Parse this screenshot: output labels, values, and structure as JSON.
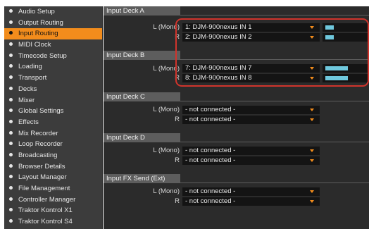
{
  "sidebar": {
    "items": [
      {
        "label": "Audio Setup",
        "active": false
      },
      {
        "label": "Output Routing",
        "active": false
      },
      {
        "label": "Input Routing",
        "active": true
      },
      {
        "label": "MIDI Clock",
        "active": false
      },
      {
        "label": "Timecode Setup",
        "active": false
      },
      {
        "label": "Loading",
        "active": false
      },
      {
        "label": "Transport",
        "active": false
      },
      {
        "label": "Decks",
        "active": false
      },
      {
        "label": "Mixer",
        "active": false
      },
      {
        "label": "Global Settings",
        "active": false
      },
      {
        "label": "Effects",
        "active": false
      },
      {
        "label": "Mix Recorder",
        "active": false
      },
      {
        "label": "Loop Recorder",
        "active": false
      },
      {
        "label": "Broadcasting",
        "active": false
      },
      {
        "label": "Browser Details",
        "active": false
      },
      {
        "label": "Layout Manager",
        "active": false
      },
      {
        "label": "File Management",
        "active": false
      },
      {
        "label": "Controller Manager",
        "active": false
      },
      {
        "label": "Traktor Kontrol X1",
        "active": false
      },
      {
        "label": "Traktor Kontrol S4",
        "active": false
      }
    ]
  },
  "sections": {
    "deck_a": {
      "title": "Input Deck A",
      "left_label": "L (Mono)",
      "right_label": "R",
      "left_value": "1: DJM-900nexus IN 1",
      "right_value": "2: DJM-900nexus IN 2",
      "left_level": 0.2,
      "right_level": 0.2
    },
    "deck_b": {
      "title": "Input Deck B",
      "left_label": "L (Mono)",
      "right_label": "R",
      "left_value": "7: DJM-900nexus IN 7",
      "right_value": "8: DJM-900nexus IN 8",
      "left_level": 0.55,
      "right_level": 0.55
    },
    "deck_c": {
      "title": "Input Deck C",
      "left_label": "L (Mono)",
      "right_label": "R",
      "left_value": "- not connected -",
      "right_value": "- not connected -"
    },
    "deck_d": {
      "title": "Input Deck D",
      "left_label": "L (Mono)",
      "right_label": "R",
      "left_value": "- not connected -",
      "right_value": "- not connected -"
    },
    "fx_send": {
      "title": "Input FX Send (Ext)",
      "left_label": "L (Mono)",
      "right_label": "R",
      "left_value": "- not connected -",
      "right_value": "- not connected -"
    }
  },
  "colors": {
    "accent": "#f28c1c",
    "meter": "#6fc8dd",
    "highlight": "#d0342c"
  }
}
